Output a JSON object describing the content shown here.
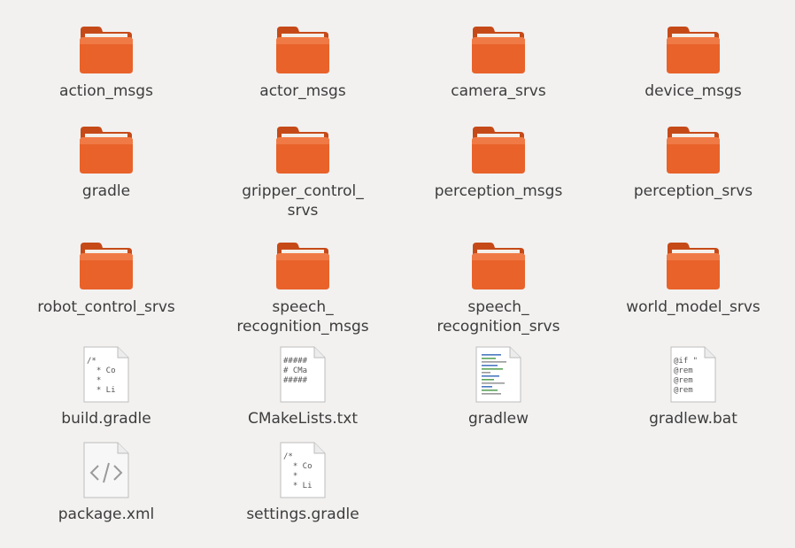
{
  "colors": {
    "background": "#f2f1f0",
    "folder_front": "#e8622a",
    "folder_back": "#c64a18",
    "label_text": "#3c3c3c"
  },
  "files": [
    {
      "name": "action_msgs",
      "type": "folder",
      "icon": "folder-icon"
    },
    {
      "name": "actor_msgs",
      "type": "folder",
      "icon": "folder-icon"
    },
    {
      "name": "camera_srvs",
      "type": "folder",
      "icon": "folder-icon"
    },
    {
      "name": "device_msgs",
      "type": "folder",
      "icon": "folder-icon"
    },
    {
      "name": "gradle",
      "type": "folder",
      "icon": "folder-icon"
    },
    {
      "name": "gripper_control_\nsrvs",
      "type": "folder",
      "icon": "folder-icon"
    },
    {
      "name": "perception_msgs",
      "type": "folder",
      "icon": "folder-icon"
    },
    {
      "name": "perception_srvs",
      "type": "folder",
      "icon": "folder-icon"
    },
    {
      "name": "robot_control_srvs",
      "type": "folder",
      "icon": "folder-icon"
    },
    {
      "name": "speech_\nrecognition_msgs",
      "type": "folder",
      "icon": "folder-icon"
    },
    {
      "name": "speech_\nrecognition_srvs",
      "type": "folder",
      "icon": "folder-icon"
    },
    {
      "name": "world_model_srvs",
      "type": "folder",
      "icon": "folder-icon"
    },
    {
      "name": "build.gradle",
      "type": "text",
      "icon": "text-file-icon",
      "preview": [
        "/*",
        "  * Co",
        "  *",
        "  * Li"
      ]
    },
    {
      "name": "CMakeLists.txt",
      "type": "text",
      "icon": "text-file-icon",
      "preview": [
        "#####",
        "# CMa",
        "#####"
      ]
    },
    {
      "name": "gradlew",
      "type": "script",
      "icon": "script-file-icon"
    },
    {
      "name": "gradlew.bat",
      "type": "text",
      "icon": "text-file-icon",
      "preview": [
        "@if \"",
        "@rem",
        "@rem",
        "@rem"
      ]
    },
    {
      "name": "package.xml",
      "type": "xml",
      "icon": "xml-file-icon",
      "preview": [
        "</>"
      ]
    },
    {
      "name": "settings.gradle",
      "type": "text",
      "icon": "text-file-icon",
      "preview": [
        "/*",
        "  * Co",
        "  *",
        "  * Li"
      ]
    }
  ]
}
